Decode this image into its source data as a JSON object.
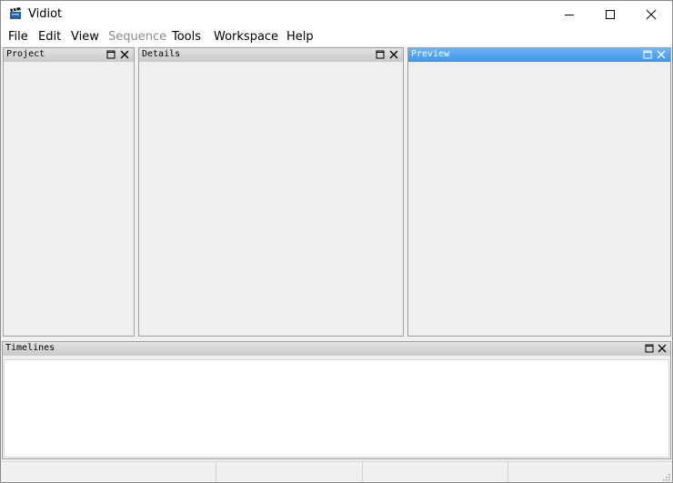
{
  "window": {
    "title": "Vidiot"
  },
  "menu": {
    "items": [
      {
        "label": "File",
        "enabled": true
      },
      {
        "label": "Edit",
        "enabled": true
      },
      {
        "label": "View",
        "enabled": true
      },
      {
        "label": "Sequence",
        "enabled": false
      },
      {
        "label": "Tools",
        "enabled": true
      },
      {
        "label": "Workspace",
        "enabled": true
      },
      {
        "label": "Help",
        "enabled": true
      }
    ]
  },
  "panes": {
    "project": {
      "title": "Project"
    },
    "details": {
      "title": "Details"
    },
    "preview": {
      "title": "Preview",
      "active": true
    },
    "timelines": {
      "title": "Timelines"
    }
  },
  "status": {
    "fields": [
      "",
      "",
      "",
      ""
    ]
  },
  "colors": {
    "active_caption": "#4a9ff0",
    "inactive_caption": "#d4d4d4",
    "disabled_text": "#8c8c8c"
  }
}
